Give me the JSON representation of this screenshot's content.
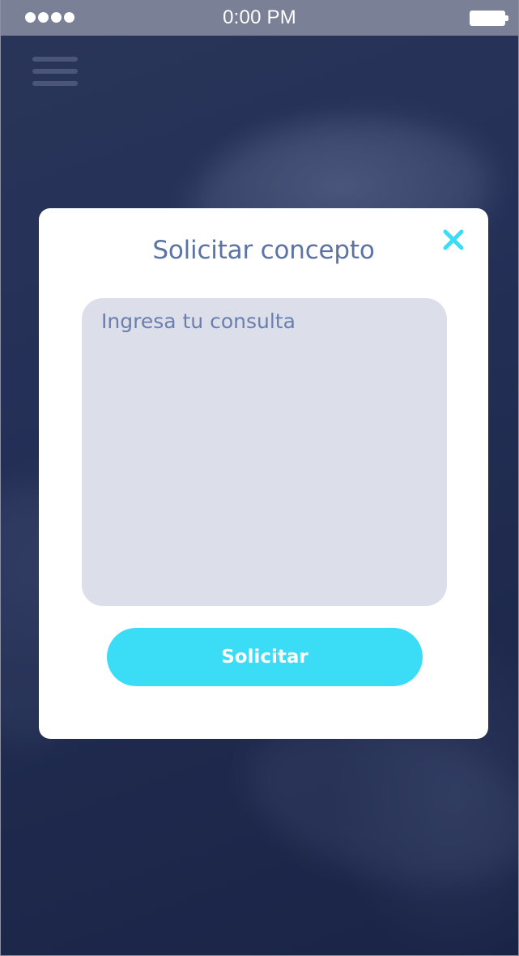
{
  "status_bar": {
    "time": "0:00 PM",
    "signal_icon": "signal-dots-icon",
    "battery_icon": "battery-icon"
  },
  "menu": {
    "icon": "hamburger-menu-icon"
  },
  "modal": {
    "title": "Solicitar concepto",
    "close_icon": "close-icon",
    "query": {
      "placeholder": "Ingresa tu consulta",
      "value": ""
    },
    "submit_label": "Solicitar"
  },
  "colors": {
    "accent": "#3adcf6",
    "title_text": "#5b73a5",
    "input_background": "#dcdfe9",
    "status_bar": "#7a8096",
    "background": "#1f2a4e"
  }
}
